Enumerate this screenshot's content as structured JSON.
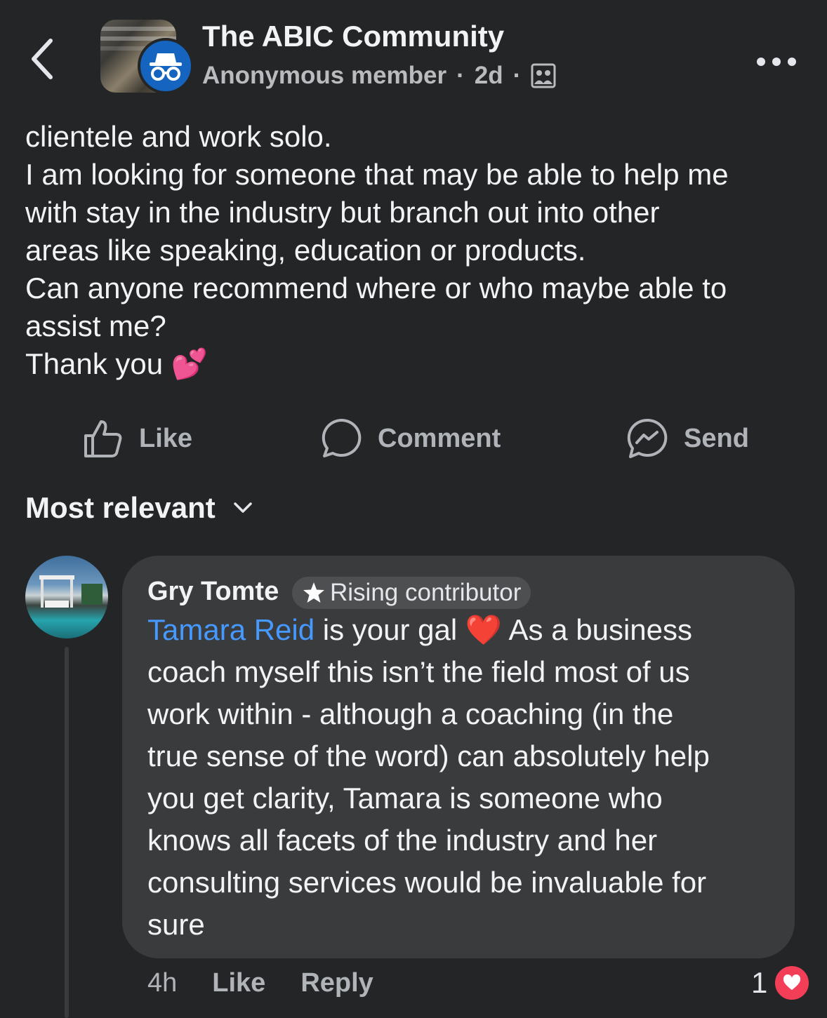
{
  "header": {
    "group_name": "The ABIC Community",
    "author": "Anonymous member",
    "separator": "·",
    "time": "2d",
    "audience_icon": "group-members-icon",
    "back_icon": "chevron-left-icon",
    "more_icon": "more-horizontal-icon"
  },
  "post": {
    "lines": [
      "clientele and work solo.",
      "I am looking for someone that may be able to help me",
      "with stay in the industry but branch out into other",
      "areas like speaking, education or products.",
      "Can anyone recommend where or who maybe able to",
      "assist me?",
      "Thank you"
    ],
    "emoji": "💕"
  },
  "actions": {
    "like": "Like",
    "comment": "Comment",
    "send": "Send"
  },
  "sort": {
    "label": "Most relevant"
  },
  "comment": {
    "author": "Gry Tomte",
    "badge": "Rising contributor",
    "mention": "Tamara Reid",
    "first_line_rest": " is your gal ",
    "heart_emoji": "❤️",
    "first_line_after": " As a business",
    "lines": [
      "coach myself this isn’t the field most of us",
      "work within - although a coaching (in the",
      "true sense of the word) can absolutely help",
      "you get clarity, Tamara is someone who",
      "knows all facets of the industry and her",
      "consulting services would be invaluable for",
      "sure"
    ],
    "time": "4h",
    "like": "Like",
    "reply": "Reply",
    "reaction_count": "1"
  },
  "colors": {
    "background": "#242526",
    "bubble": "#3a3b3c",
    "mention": "#4599ff",
    "reaction_heart": "#f33e58",
    "avatar_blue": "#1565c0"
  }
}
